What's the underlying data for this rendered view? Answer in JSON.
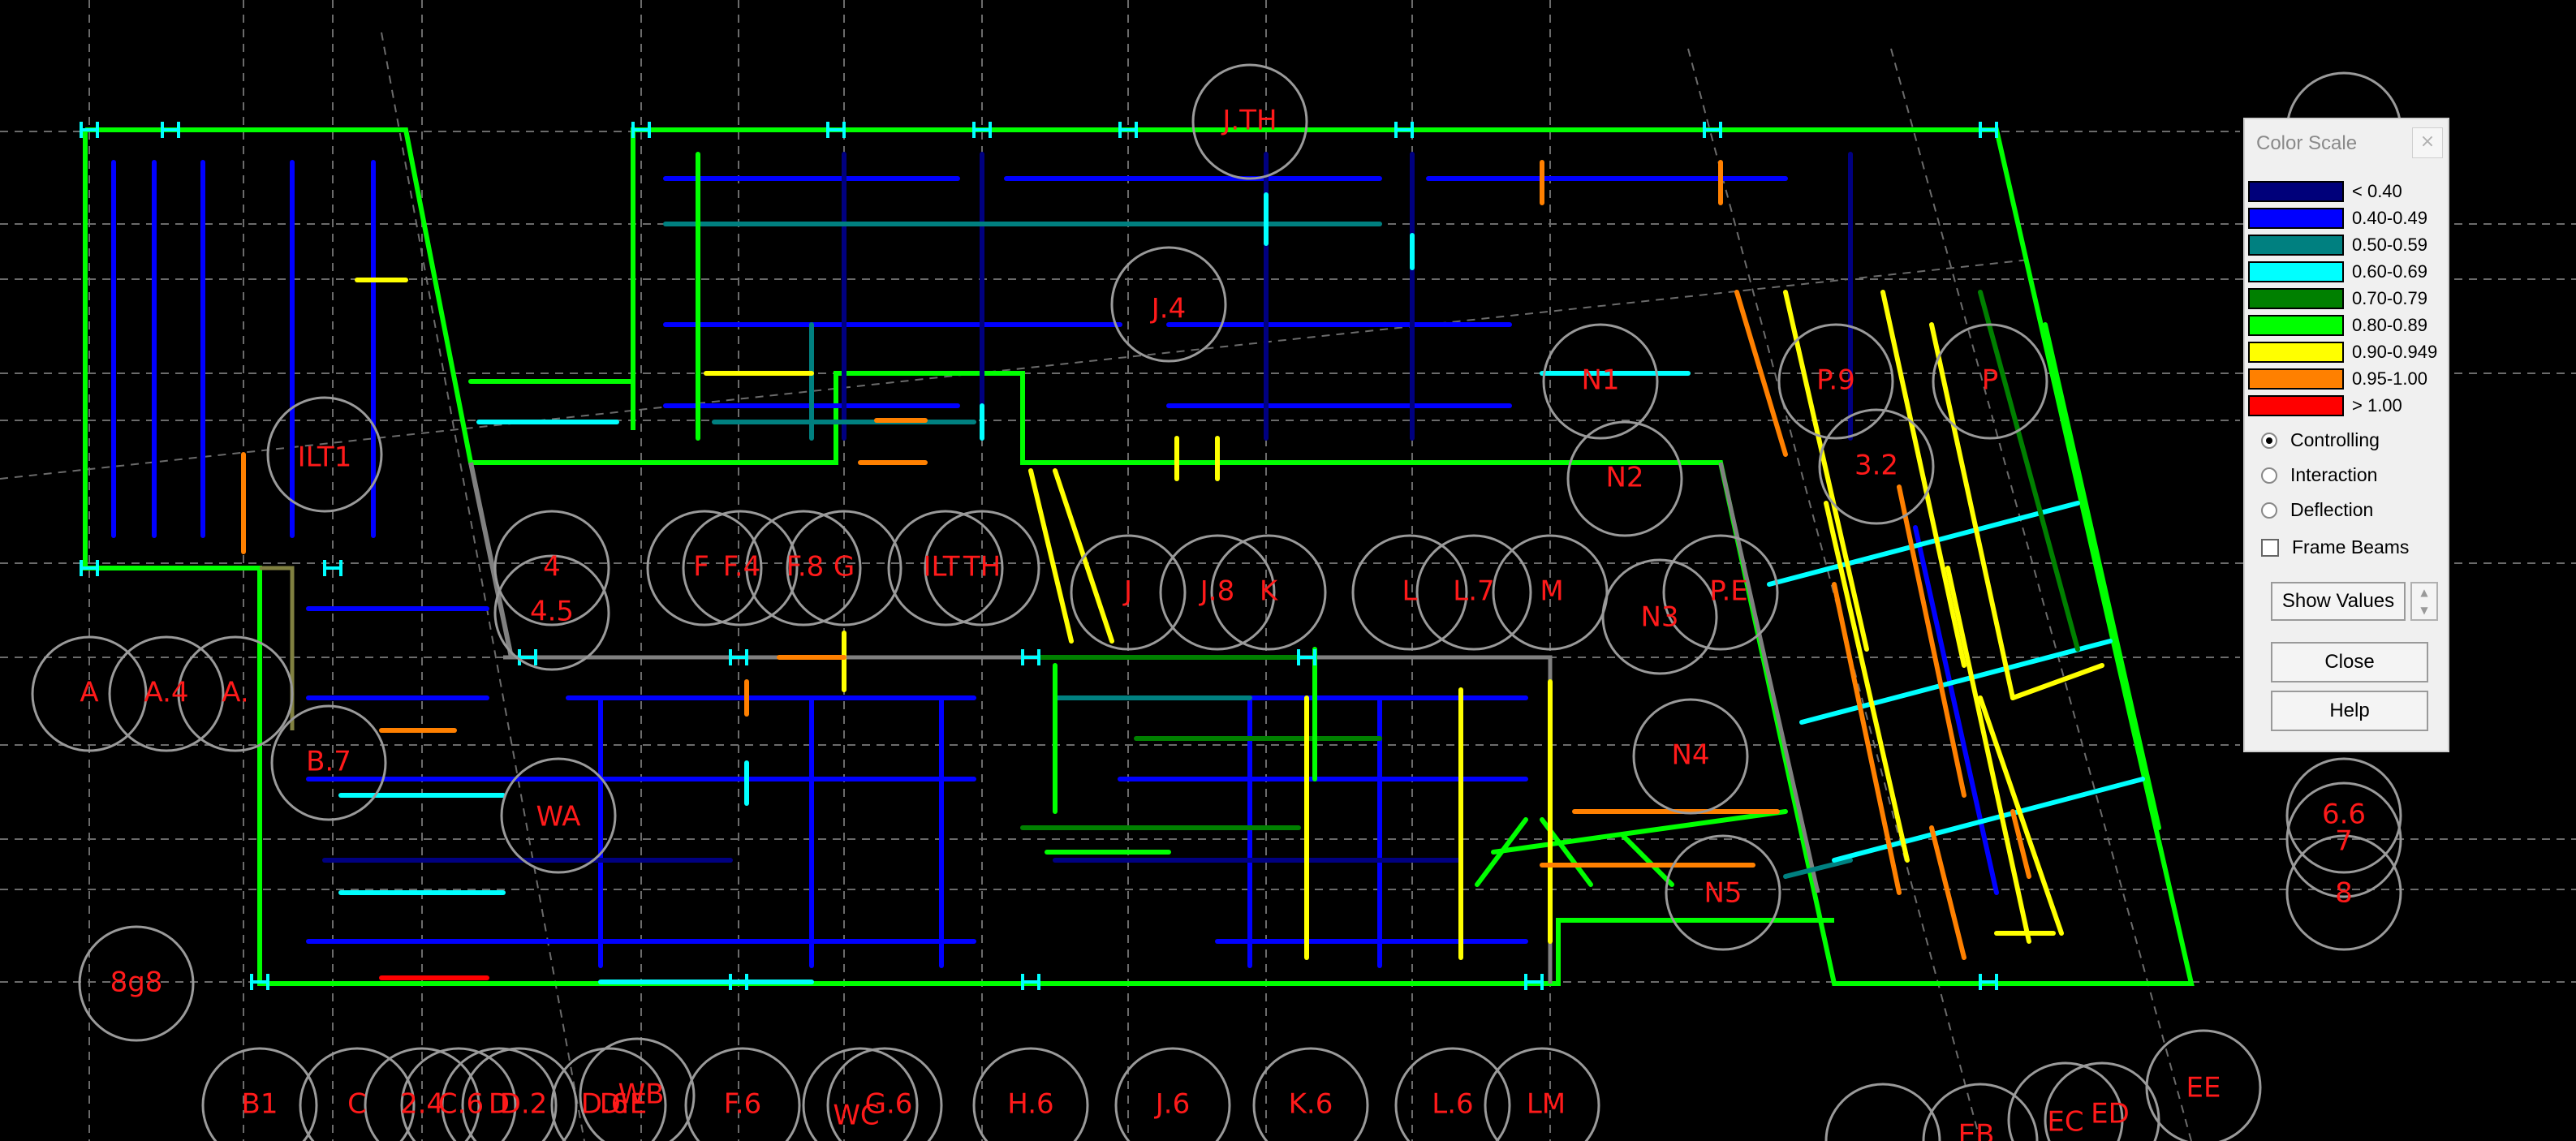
{
  "plan": {
    "grid_labels": {
      "top": [
        "J.TH"
      ],
      "left": [
        "A",
        "A.4",
        "A.",
        "B.7",
        "WA",
        "8g8"
      ],
      "interior": [
        "J.4",
        "4",
        "4.5",
        "F",
        "F.4",
        "F.8",
        "G",
        "ILT",
        "TH",
        "J",
        "J.8",
        "K",
        "L",
        "L.7",
        "M",
        "ILT1"
      ],
      "right": [
        "N1",
        "N2",
        "N3",
        "N4",
        "N5",
        "P.9",
        "P",
        "3.2",
        "P.E",
        "6.6",
        "7",
        "8"
      ],
      "bottom": [
        "B1",
        "C",
        "2.4",
        "C.6",
        "D",
        "D.2",
        "D.6",
        "D.E",
        "WB",
        "F.6",
        "WC",
        "G.6",
        "H.6",
        "J.6",
        "K.6",
        "L.6",
        "LM",
        "EB",
        "EC",
        "ED",
        "EE"
      ]
    }
  },
  "color_scale": {
    "title": "Color Scale",
    "close_glyph": "×",
    "legend": [
      {
        "label": "< 0.40",
        "color": "#00007a"
      },
      {
        "label": "0.40-0.49",
        "color": "#0000ff"
      },
      {
        "label": "0.50-0.59",
        "color": "#008080"
      },
      {
        "label": "0.60-0.69",
        "color": "#00ffff"
      },
      {
        "label": "0.70-0.79",
        "color": "#008000"
      },
      {
        "label": "0.80-0.89",
        "color": "#00ff00"
      },
      {
        "label": "0.90-0.949",
        "color": "#ffff00"
      },
      {
        "label": "0.95-1.00",
        "color": "#ff8000"
      },
      {
        "label": "> 1.00",
        "color": "#ff0000"
      }
    ],
    "options": {
      "controlling": "Controlling",
      "interaction": "Interaction",
      "deflection": "Deflection",
      "selected": "Controlling"
    },
    "frame_beams": "Frame Beams",
    "show_values": "Show Values",
    "close": "Close",
    "help": "Help"
  }
}
